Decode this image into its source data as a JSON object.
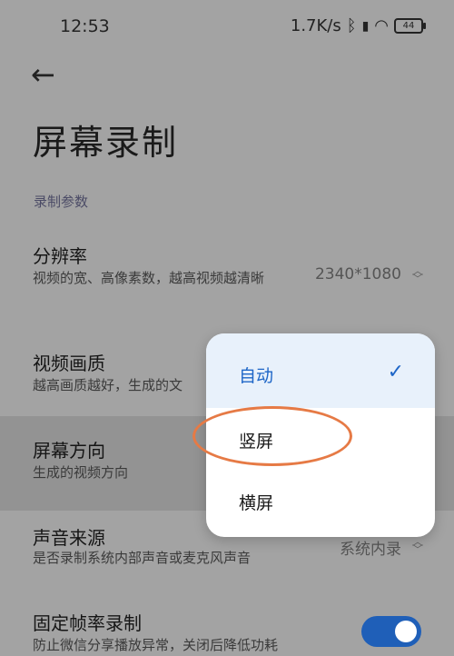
{
  "status_bar": {
    "time": "12:53",
    "speed": "1.7K/s",
    "battery": "44"
  },
  "page": {
    "title": "屏幕录制",
    "section": "录制参数"
  },
  "rows": [
    {
      "title": "分辨率",
      "desc": "视频的宽、高像素数，越高视频越清晰",
      "value": "2340*1080"
    },
    {
      "title": "视频画质",
      "desc": "越高画质越好，生成的文"
    },
    {
      "title": "屏幕方向",
      "desc": "生成的视频方向"
    },
    {
      "title": "声音来源",
      "desc": "是否录制系统内部声音或麦克风声音",
      "value": "系统内录"
    },
    {
      "title": "固定帧率录制",
      "desc": "防止微信分享播放异常，关闭后降低功耗"
    }
  ],
  "popup": {
    "options": [
      "自动",
      "竖屏",
      "横屏"
    ],
    "selected": "自动"
  },
  "colors": {
    "accent": "#1e66c7",
    "highlight_circle": "#e67a45"
  }
}
